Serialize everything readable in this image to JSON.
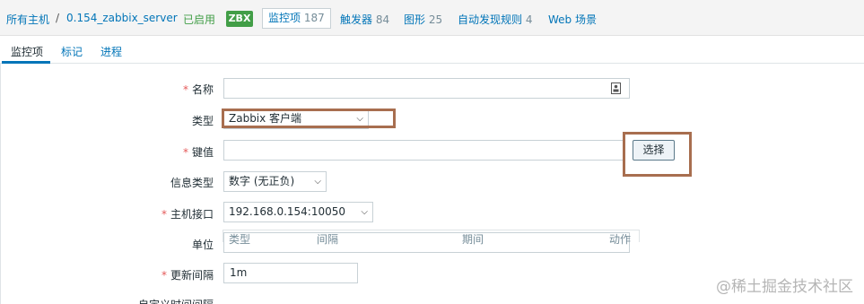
{
  "breadcrumb": {
    "all_hosts": "所有主机",
    "separator": "/",
    "host": "0.154_zabbix_server",
    "status": "已启用",
    "zbx_badge": "ZBX",
    "items_label": "监控项",
    "items_count": "187",
    "triggers_label": "触发器",
    "triggers_count": "84",
    "graphs_label": "图形",
    "graphs_count": "25",
    "discovery_label": "自动发现规则",
    "discovery_count": "4",
    "web_label": "Web 场景"
  },
  "tabs": [
    {
      "label": "监控项"
    },
    {
      "label": "标记"
    },
    {
      "label": "进程"
    }
  ],
  "form": {
    "name_label": "名称",
    "type_label": "类型",
    "type_value": "Zabbix 客户端",
    "key_label": "键值",
    "key_value": "",
    "select_button": "选择",
    "info_type_label": "信息类型",
    "info_type_value": "数字 (无正负)",
    "interface_label": "主机接口",
    "interface_value": "192.168.0.154:10050",
    "units_label": "单位",
    "units_value": "",
    "interval_label": "更新间隔",
    "interval_value": "1m",
    "custom_intervals_label": "自定义时间间隔",
    "custom_intervals_columns": [
      "类型",
      "间隔",
      "期间",
      "动作"
    ]
  },
  "watermark": "@稀土掘金技术社区",
  "colors": {
    "link": "#0275b8",
    "enabled": "#429e47",
    "annotation": "#a86e4f",
    "required": "#e45959"
  }
}
